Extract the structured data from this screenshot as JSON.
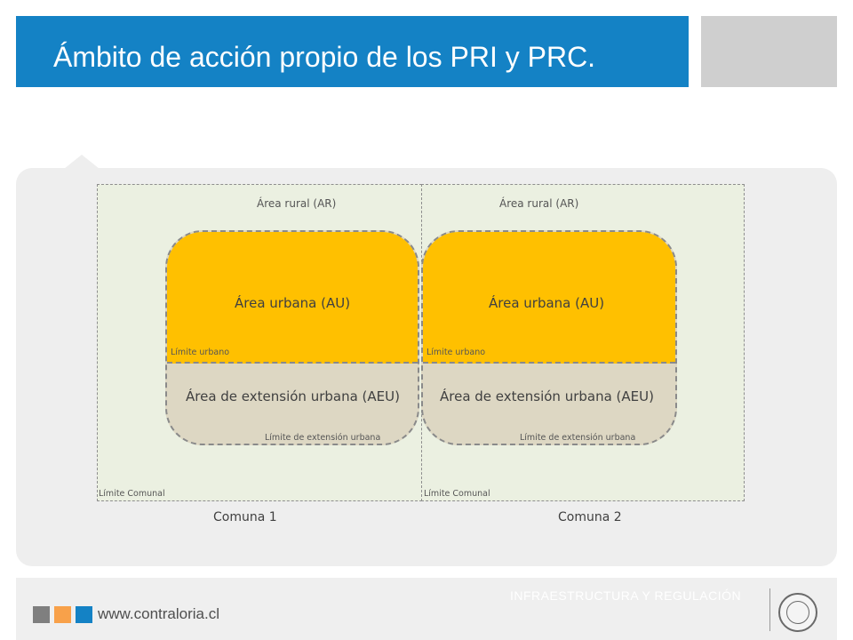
{
  "header": {
    "title": "Ámbito de acción propio de los PRI y PRC."
  },
  "diagram": {
    "comunas": [
      {
        "name": "Comuna 1",
        "rural": "Área rural (AR)",
        "urban": "Área urbana (AU)",
        "extension": "Área de extensión urbana (AEU)",
        "limite_urbano": "Límite urbano",
        "limite_extension": "Límite de extensión urbana",
        "limite_comunal": "Límite Comunal"
      },
      {
        "name": "Comuna 2",
        "rural": "Área rural (AR)",
        "urban": "Área urbana (AU)",
        "extension": "Área de extensión urbana (AEU)",
        "limite_urbano": "Límite urbano",
        "limite_extension": "Límite de extensión urbana",
        "limite_comunal": "Límite Comunal"
      }
    ],
    "colors": {
      "urban": "#ffc000",
      "extension": "#ddd7c3",
      "rural": "#ebf0e1"
    }
  },
  "footer": {
    "website": "www.contraloria.cl",
    "section": "INFRAESTRUCTURA Y REGULACIÓN",
    "seal": "contraloria-seal-icon"
  }
}
